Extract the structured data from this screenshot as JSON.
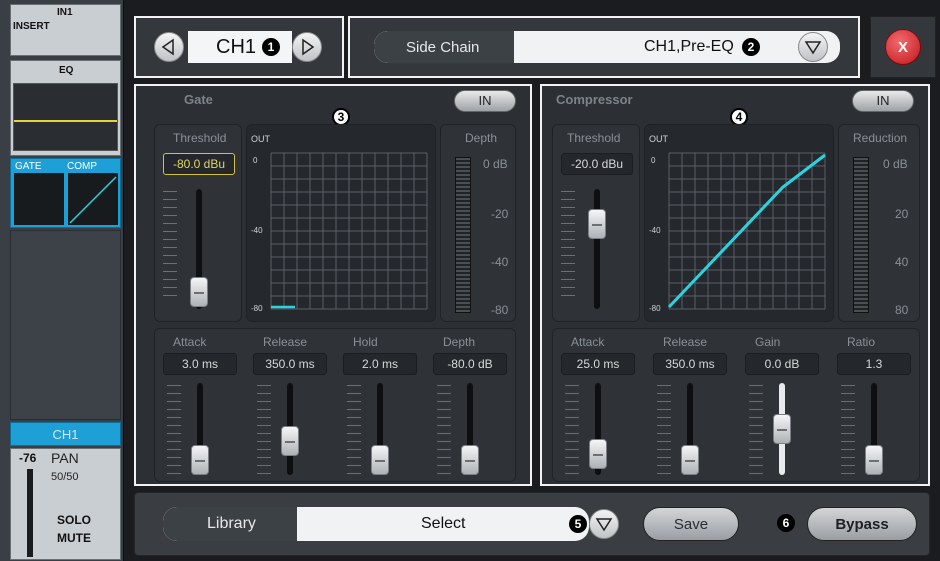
{
  "strip": {
    "insert_line1": "IN1",
    "insert_line2": "INSERT",
    "eq_label": "EQ",
    "gate_label": "GATE",
    "comp_label": "COMP",
    "channel": "CH1",
    "level": "-76",
    "pan_label": "PAN",
    "pan_value": "50/50",
    "solo": "SOLO",
    "mute": "MUTE"
  },
  "header": {
    "channel_name": "CH1",
    "side_chain_label": "Side Chain",
    "side_chain_value": "CH1,Pre-EQ",
    "prev_icon": "triangle-left",
    "next_icon": "triangle-right",
    "close_label": "X"
  },
  "markers": {
    "m1": "1",
    "m2": "2",
    "m3": "3",
    "m4": "4",
    "m5": "5",
    "m6": "6"
  },
  "gate": {
    "title": "Gate",
    "in_label": "IN",
    "threshold_label": "Threshold",
    "threshold_value": "-80.0 dBu",
    "threshold_level": 0.0,
    "graph_out": "OUT",
    "graph_ticks": [
      "0",
      "-40",
      "-80"
    ],
    "depth_label": "Depth",
    "depth_scale": [
      "0 dB",
      "-20",
      "-40",
      "-80"
    ],
    "params": [
      {
        "label": "Attack",
        "value": "3.0 ms",
        "level": 0.0
      },
      {
        "label": "Release",
        "value": "350.0 ms",
        "level": 0.3
      },
      {
        "label": "Hold",
        "value": "2.0 ms",
        "level": 0.0
      },
      {
        "label": "Depth",
        "value": "-80.0 dB",
        "level": 0.0
      }
    ]
  },
  "compressor": {
    "title": "Compressor",
    "in_label": "IN",
    "threshold_label": "Threshold",
    "threshold_value": "-20.0 dBu",
    "threshold_level": 0.75,
    "graph_out": "OUT",
    "graph_ticks": [
      "0",
      "-40",
      "-80"
    ],
    "reduction_label": "Reduction",
    "reduction_scale": [
      "0 dB",
      "20",
      "40",
      "80"
    ],
    "params": [
      {
        "label": "Attack",
        "value": "25.0 ms",
        "level": 0.1
      },
      {
        "label": "Release",
        "value": "350.0 ms",
        "level": 0.0
      },
      {
        "label": "Gain",
        "value": "0.0 dB",
        "level": 0.5
      },
      {
        "label": "Ratio",
        "value": "1.3",
        "level": 0.0
      }
    ]
  },
  "footer": {
    "library_label": "Library",
    "select_value": "Select",
    "save_label": "Save",
    "bypass_label": "Bypass"
  },
  "colors": {
    "accent": "#1e9fd6",
    "curve": "#29d3df",
    "close_red": "#d1252a",
    "threshold_box": "#d6c33a"
  }
}
